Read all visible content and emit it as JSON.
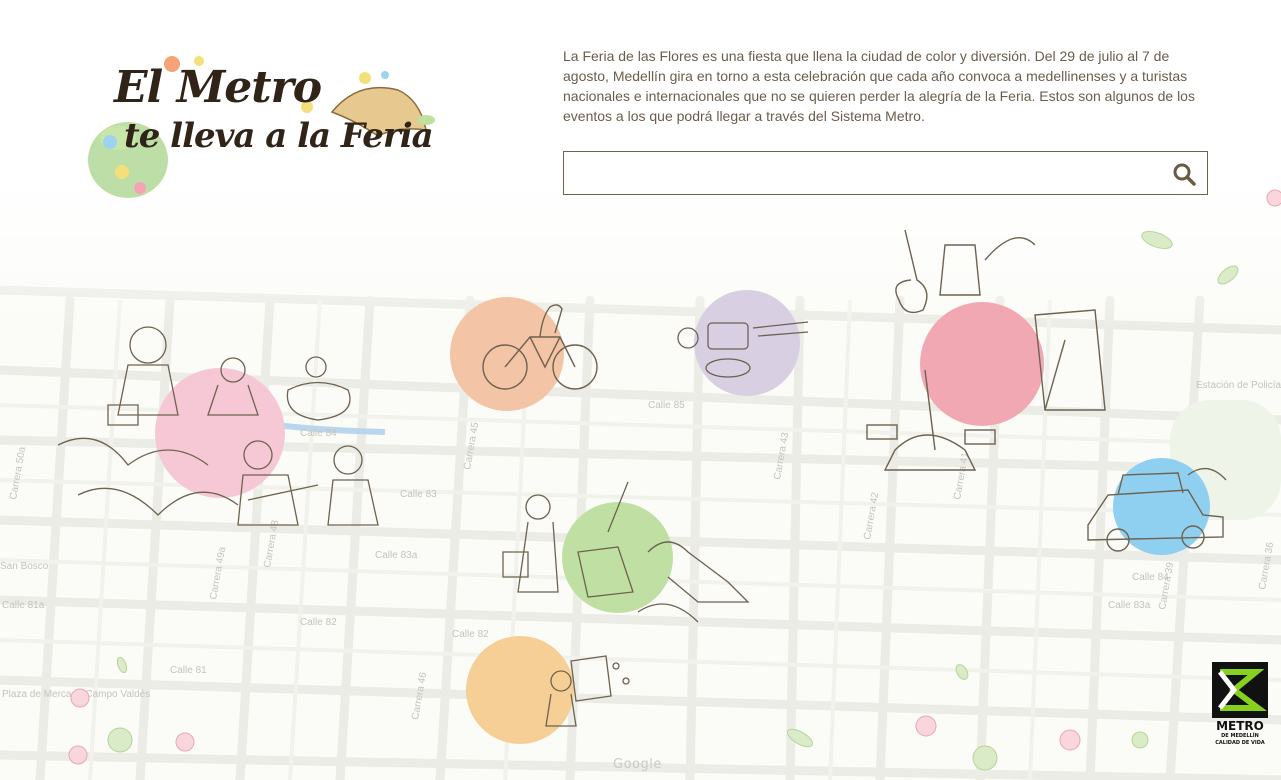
{
  "logo": {
    "line1": "El Metro",
    "line2": "te lleva a la Feria"
  },
  "intro": {
    "text": "La Feria de las Flores es una fiesta que llena la ciudad de color y diversión. Del 29 de julio al 7 de agosto, Medellín gira en torno a esta celebración que cada año convoca a medellinenses y a turistas nacionales e internacionales que no se quieren perder la alegría de la Feria. Estos son algunos de los eventos a los que podrá llegar a través del Sistema Metro."
  },
  "search": {
    "value": "",
    "icon": "search-icon"
  },
  "events": [
    {
      "name": "event-cyclists",
      "color": "#f4c4a6",
      "icon": "bicycle-icon"
    },
    {
      "name": "event-gastronomy",
      "color": "#d8cfe3",
      "icon": "food-icon"
    },
    {
      "name": "event-music-concert",
      "color": "#f2a8b3",
      "icon": "guitar-icon"
    },
    {
      "name": "event-trova-festival",
      "color": "#f6c8d6",
      "icon": "musicians-icon"
    },
    {
      "name": "event-pets-and-sport",
      "color": "#bfe0a2",
      "icon": "dog-icon"
    },
    {
      "name": "event-antique-cars",
      "color": "#8fd0f0",
      "icon": "car-icon"
    },
    {
      "name": "event-silleteros",
      "color": "#f5cf95",
      "icon": "silleta-icon"
    }
  ],
  "map": {
    "streets": [
      "Calle 85",
      "Calle 84",
      "Calle 83a",
      "Calle 83",
      "Calle 82",
      "Calle 81",
      "Calle 84",
      "Calle 83a",
      "Calle 82",
      "Carrera 49a",
      "Carrera 48",
      "Carrera 46",
      "Carrera 45",
      "Carrera 43",
      "Carrera 42",
      "Carrera 41",
      "Carrera 39",
      "Carrera 36",
      "Carrera 50a",
      "Calle 81a"
    ],
    "places": [
      "Plaza de Mercado Campo Valdés",
      "Estación de Policía San Blas",
      "San Bosco"
    ],
    "attribution": "Google"
  },
  "metro": {
    "name": "METRO",
    "sub": "DE MEDELLÍN",
    "tagline": "CALIDAD DE VIDA"
  }
}
